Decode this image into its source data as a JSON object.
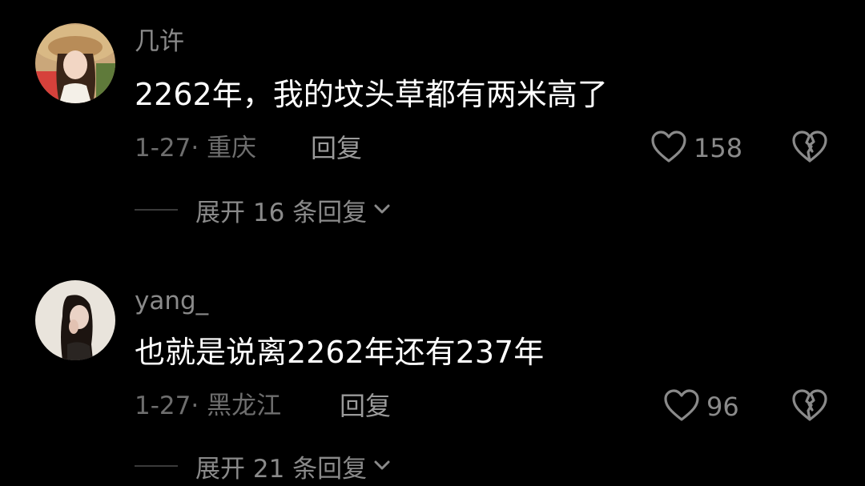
{
  "comments": [
    {
      "username": "几许",
      "text": "2262年，我的坟头草都有两米高了",
      "meta": "1-27· 重庆",
      "reply_label": "回复",
      "like_count": "158",
      "expand_label": "展开 16 条回复"
    },
    {
      "username": "yang_",
      "text": "也就是说离2262年还有237年",
      "meta": "1-27· 黑龙江",
      "reply_label": "回复",
      "like_count": "96",
      "expand_label": "展开 21 条回复"
    }
  ],
  "icons": {
    "like": "heart-outline-icon",
    "dislike": "broken-heart-icon",
    "expand": "chevron-down-icon"
  },
  "colors": {
    "background": "#000000",
    "text_primary": "#ffffff",
    "text_secondary": "#8a8a8a",
    "text_meta": "#6e6e6e"
  }
}
